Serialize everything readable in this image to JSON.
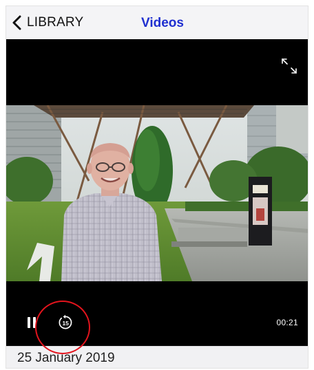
{
  "nav": {
    "back_label": "LIBRARY",
    "title": "Videos"
  },
  "player": {
    "time": "00:21",
    "skip_back_seconds": "15",
    "highlight_color": "#e3141d",
    "state": "playing"
  },
  "footer": {
    "date": "25 January 2019"
  },
  "colors": {
    "title": "#1f2fd0",
    "navbar_bg": "#f4f4f6",
    "player_bg": "#000000"
  }
}
